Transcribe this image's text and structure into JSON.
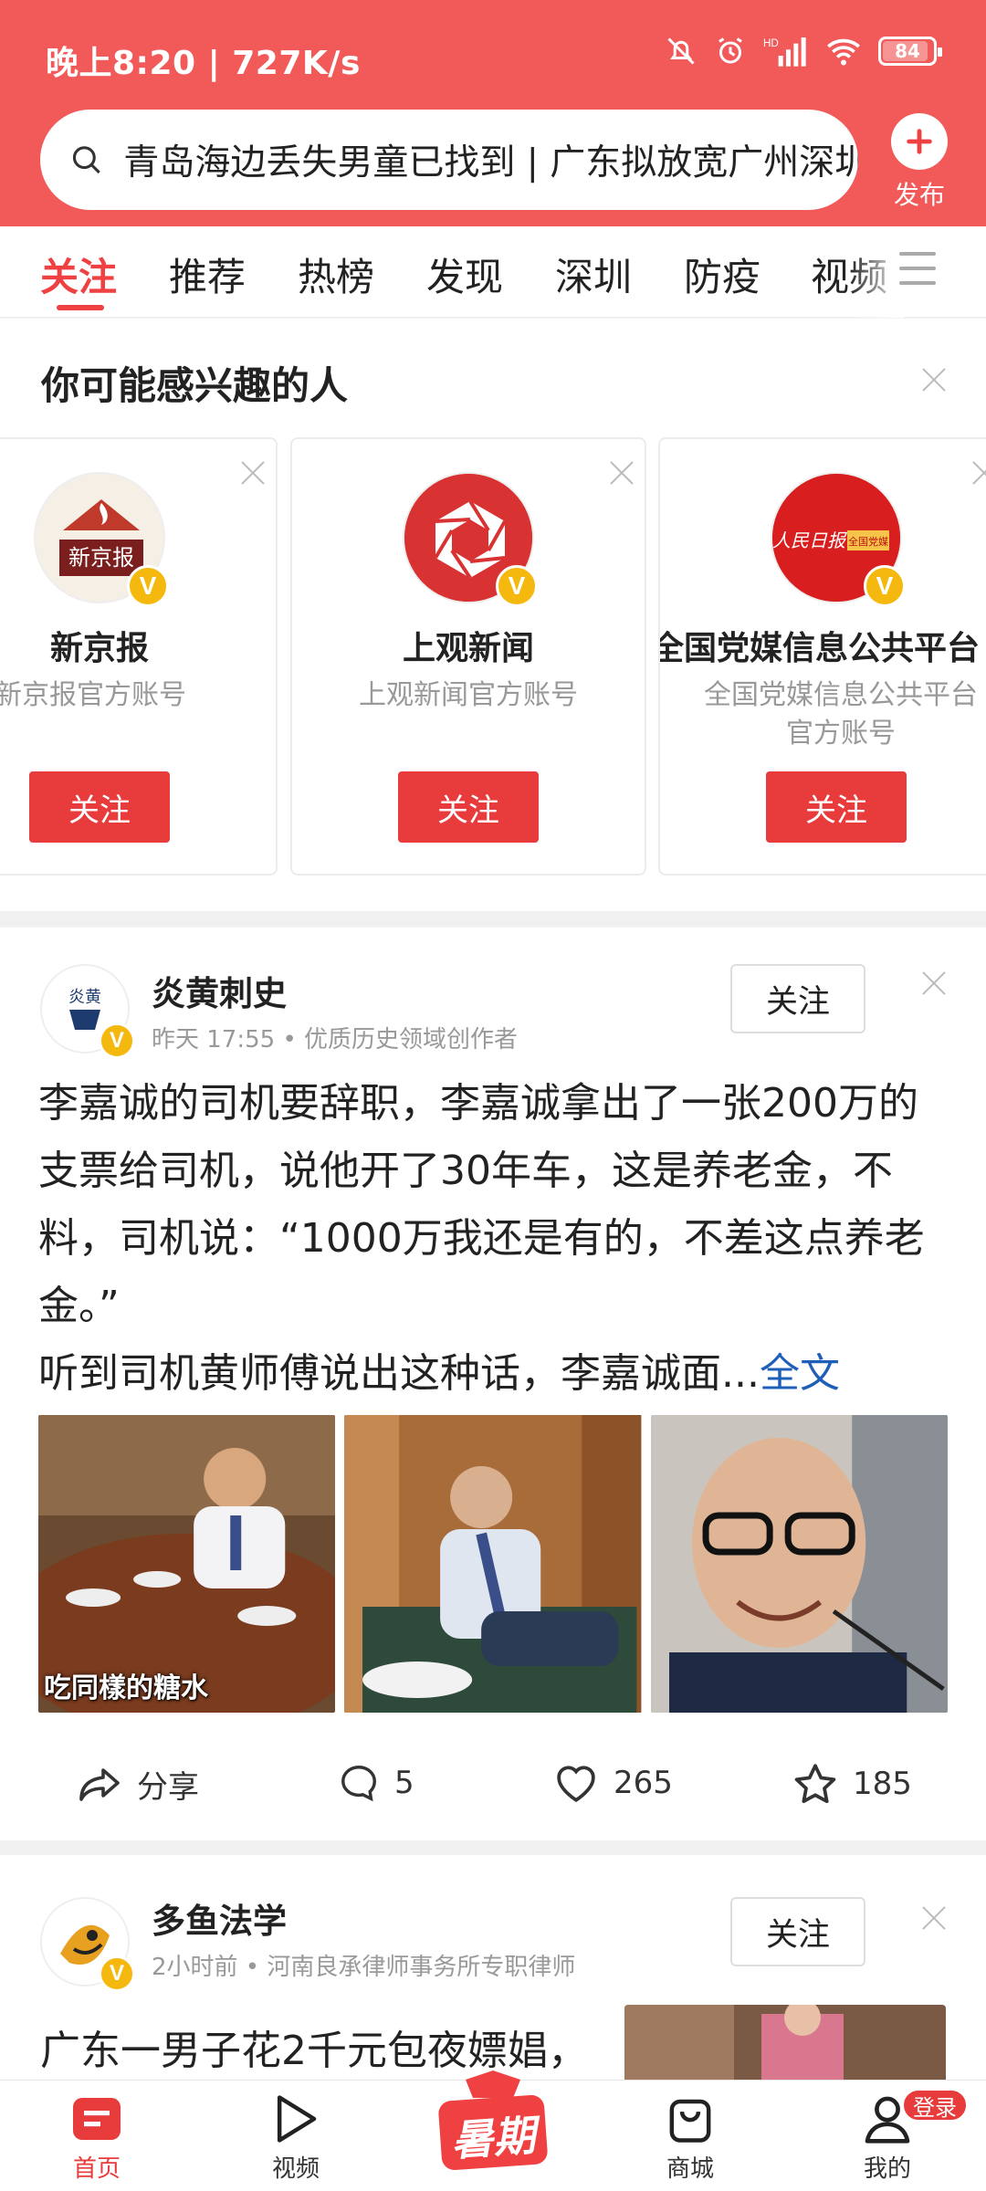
{
  "status_bar": {
    "time": "晚上8:20 | 727K/s",
    "battery": "84"
  },
  "header": {
    "search_text": "青岛海边丢失男童已找到 | 广东拟放宽广州深圳",
    "publish_label": "发布"
  },
  "tabs": [
    {
      "label": "关注",
      "active": true
    },
    {
      "label": "推荐"
    },
    {
      "label": "热榜"
    },
    {
      "label": "发现"
    },
    {
      "label": "深圳"
    },
    {
      "label": "防疫"
    },
    {
      "label": "视频"
    }
  ],
  "suggest": {
    "title": "你可能感兴趣的人",
    "cards": [
      {
        "name": "新京报",
        "desc": "新京报官方账号",
        "follow": "关注"
      },
      {
        "name": "上观新闻",
        "desc": "上观新闻官方账号",
        "follow": "关注"
      },
      {
        "name": "全国党媒信息公共平台",
        "desc": "全国党媒信息公共平台官方账号",
        "follow": "关注"
      }
    ]
  },
  "posts": [
    {
      "author": "炎黄刺史",
      "meta": "昨天 17:55 • 优质历史领域创作者",
      "follow": "关注",
      "body": "李嘉诚的司机要辞职，李嘉诚拿出了一张200万的支票给司机，说他开了30年车，这是养老金，不料，司机说：“1000万我还是有的，不差这点养老金。”",
      "body2": "听到司机黄师傅说出这种话，李嘉诚面...",
      "more": "全文",
      "image_caption": "吃同樣的糖水",
      "share": "分享",
      "comments": "5",
      "likes": "265",
      "favorites": "185"
    },
    {
      "author": "多鱼法学",
      "meta": "2小时前 • 河南良承律师事务所专职律师",
      "follow": "关注",
      "body": "广东一男子花2千元包夜嫖娼，"
    }
  ],
  "bottom_nav": {
    "home": "首页",
    "video": "视频",
    "summer": "暑期",
    "mall": "商城",
    "me": "我的",
    "login": "登录"
  },
  "colors": {
    "brand_red": "#f25a5a",
    "accent_red": "#e83b3b",
    "link_blue": "#1f5fb8",
    "verified_gold": "#f5b80f"
  }
}
